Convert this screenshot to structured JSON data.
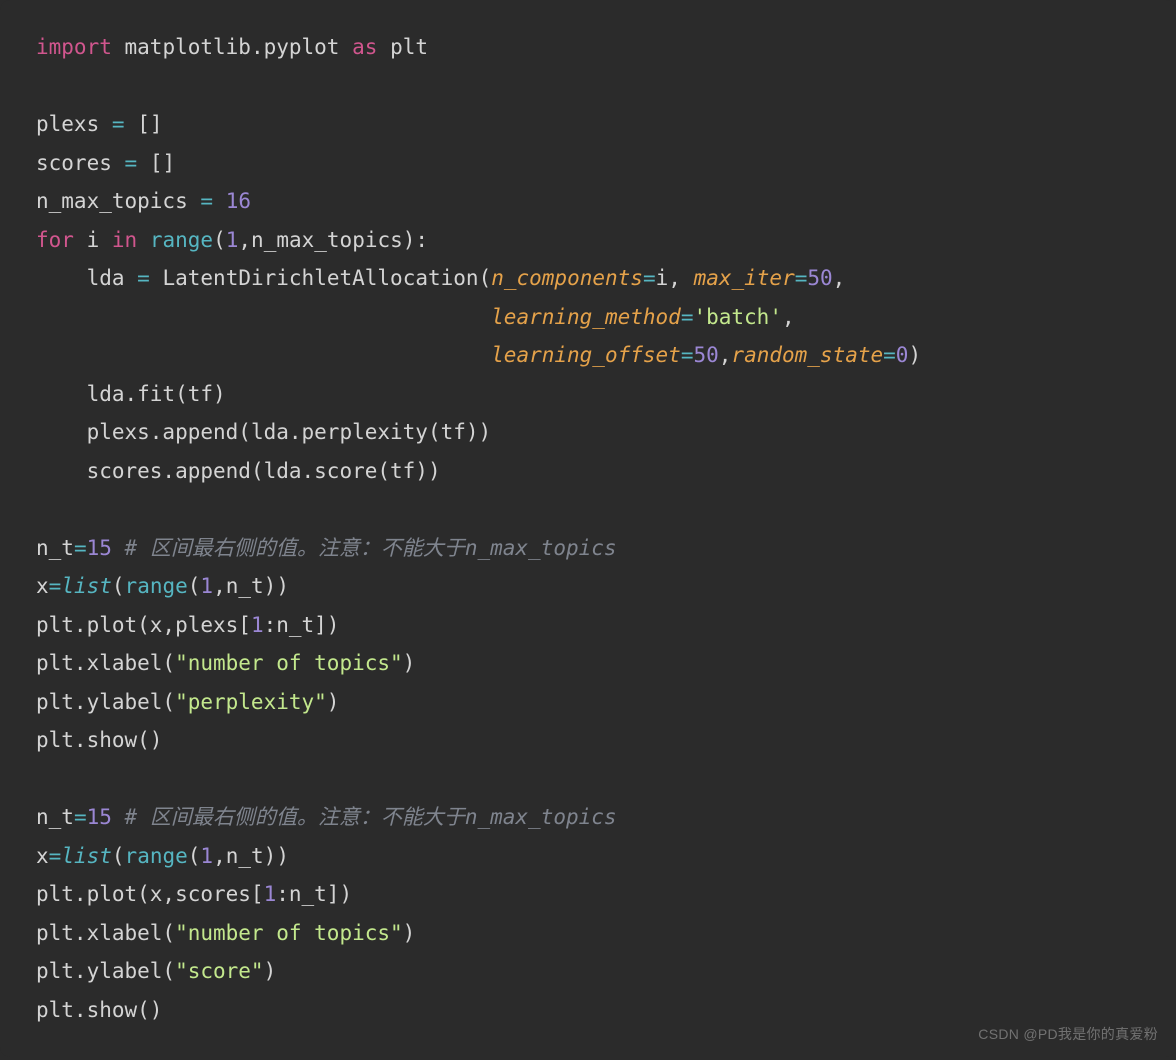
{
  "code": {
    "l1": {
      "import": "import",
      "mod": "matplotlib.pyplot",
      "as": "as",
      "alias": "plt"
    },
    "l3": {
      "var": "plexs",
      "eq": "=",
      "val": "[]"
    },
    "l4": {
      "var": "scores",
      "eq": "=",
      "val": "[]"
    },
    "l5": {
      "var": "n_max_topics",
      "eq": "=",
      "val": "16"
    },
    "l6": {
      "for": "for",
      "i": "i",
      "in": "in",
      "range": "range",
      "args": "(",
      "a1": "1",
      "comma": ",",
      "a2": "n_max_topics",
      "close": "):"
    },
    "l7": {
      "indent": "    ",
      "lda": "lda",
      "eq": "=",
      "cls": "LatentDirichletAllocation",
      "open": "(",
      "p1": "n_components",
      "eq1": "=",
      "v1": "i",
      "c1": ",",
      "p2": "max_iter",
      "eq2": "=",
      "v2": "50",
      "c2": ","
    },
    "l8": {
      "pad": "                                    ",
      "p3": "learning_method",
      "eq3": "=",
      "v3": "'batch'",
      "c3": ","
    },
    "l9": {
      "pad": "                                    ",
      "p4": "learning_offset",
      "eq4": "=",
      "v4": "50",
      "c4": ",",
      "p5": "random_state",
      "eq5": "=",
      "v5": "0",
      "close": ")"
    },
    "l10": {
      "indent": "    ",
      "call": "lda.fit(tf)"
    },
    "l11": {
      "indent": "    ",
      "call": "plexs.append(lda.perplexity(tf))"
    },
    "l12": {
      "indent": "    ",
      "call": "scores.append(lda.score(tf))"
    },
    "l14": {
      "var": "n_t",
      "eq": "=",
      "val": "15",
      "cmt": "# 区间最右侧的值。注意：不能大于n_max_topics"
    },
    "l15": {
      "x": "x",
      "eq": "=",
      "list": "list",
      "open": "(",
      "range": "range",
      "args": "(",
      "a1": "1",
      "c": ",",
      "a2": "n_t",
      "close": "))"
    },
    "l16": {
      "call_a": "plt.plot(x,plexs[",
      "n1": "1",
      "mid": ":n_t])"
    },
    "l17": {
      "call": "plt.xlabel(",
      "str": "\"number of topics\"",
      "close": ")"
    },
    "l18": {
      "call": "plt.ylabel(",
      "str": "\"perplexity\"",
      "close": ")"
    },
    "l19": {
      "call": "plt.show()"
    },
    "l21": {
      "var": "n_t",
      "eq": "=",
      "val": "15",
      "cmt": "# 区间最右侧的值。注意：不能大于n_max_topics"
    },
    "l22": {
      "x": "x",
      "eq": "=",
      "list": "list",
      "open": "(",
      "range": "range",
      "args": "(",
      "a1": "1",
      "c": ",",
      "a2": "n_t",
      "close": "))"
    },
    "l23": {
      "call_a": "plt.plot(x,scores[",
      "n1": "1",
      "mid": ":n_t])"
    },
    "l24": {
      "call": "plt.xlabel(",
      "str": "\"number of topics\"",
      "close": ")"
    },
    "l25": {
      "call": "plt.ylabel(",
      "str": "\"score\"",
      "close": ")"
    },
    "l26": {
      "call": "plt.show()"
    }
  },
  "watermark": "CSDN @PD我是你的真爱粉"
}
